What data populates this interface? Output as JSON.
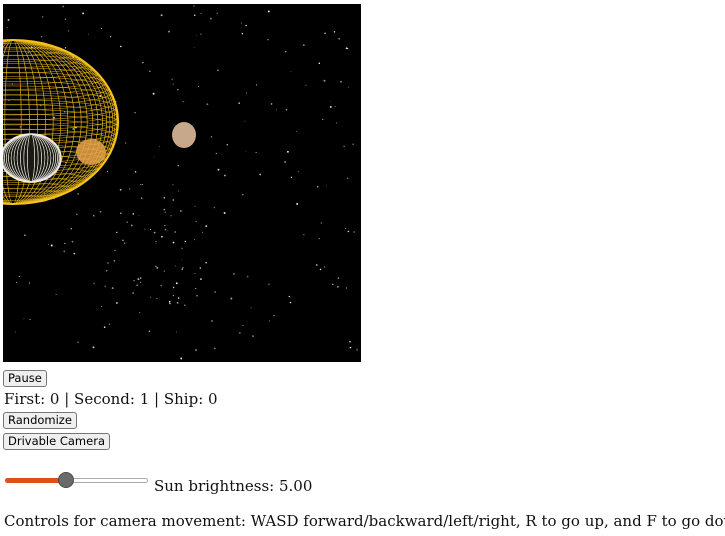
{
  "buttons": {
    "pause": "Pause",
    "randomize": "Randomize",
    "drivable_camera": "Drivable Camera"
  },
  "counts": {
    "text": "First: 0 | Second: 1 | Ship: 0"
  },
  "sun_brightness": {
    "label": "Sun brightness: 5.00",
    "slider_fraction": 0.42
  },
  "controls_text": "Controls for camera movement: WASD forward/backward/left/right, R to go up, and F to go down",
  "scene": {
    "background_color": "#000000",
    "sun_color": "#f5c21a",
    "orbit_ring_color": "#f0ede4",
    "planet_orange_color": "#e8a54a",
    "planet_tan_color": "#c8a88a"
  }
}
